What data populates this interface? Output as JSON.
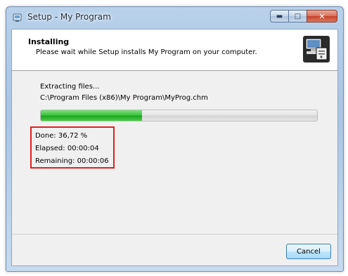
{
  "window": {
    "title": "Setup - My Program"
  },
  "header": {
    "title": "Installing",
    "subtitle": "Please wait while Setup installs My Program on your computer."
  },
  "status": {
    "action": "Extracting files...",
    "file": "C:\\Program Files (x86)\\My Program\\MyProg.chm"
  },
  "progress": {
    "fraction": 0.3672
  },
  "stats": {
    "done": "Done: 36,72 %",
    "elapsed": "Elapsed: 00:00:04",
    "remaining": "Remaining: 00:00:06"
  },
  "buttons": {
    "cancel": "Cancel"
  },
  "icons": {
    "app": "setup-app-icon",
    "minimize": "minimize-icon",
    "maximize": "maximize-icon",
    "close": "close-icon",
    "header_logo": "computer-install-icon"
  },
  "colors": {
    "progress_green": "#2fb52f",
    "highlight_border": "#e02020"
  }
}
